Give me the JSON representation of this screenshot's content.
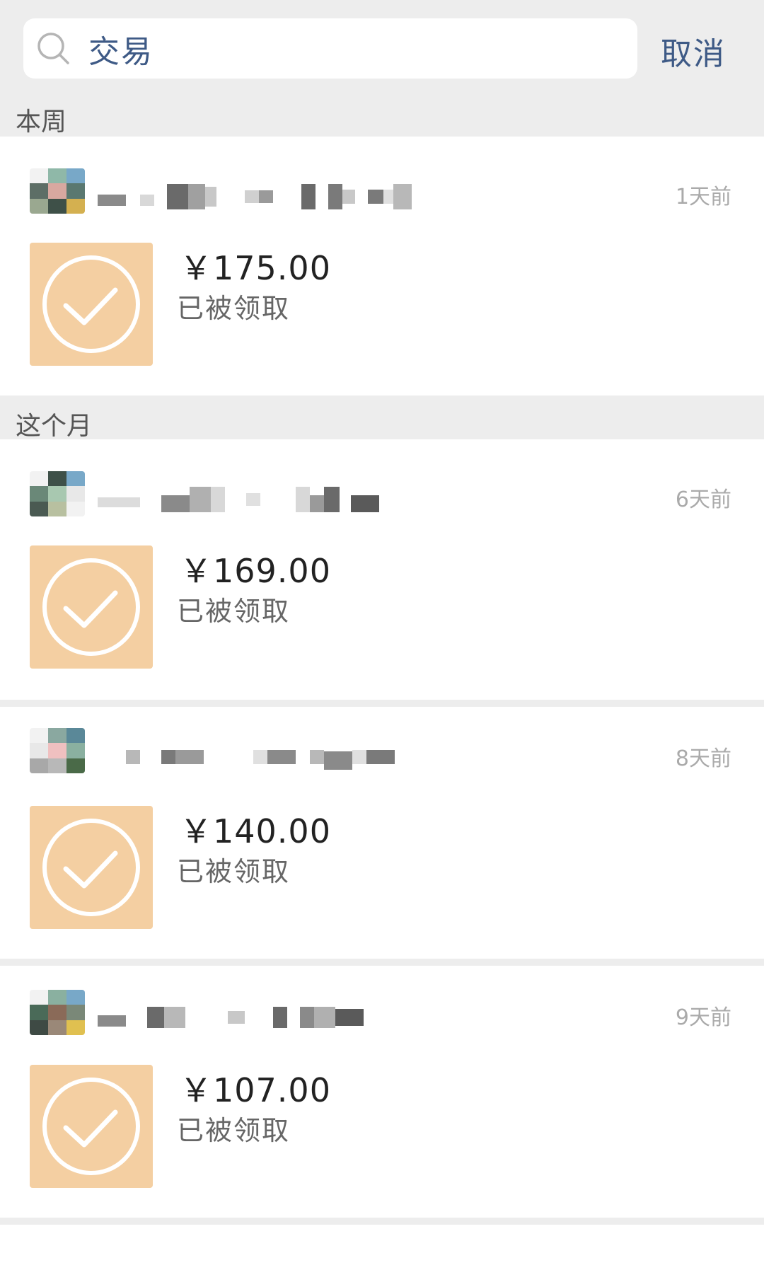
{
  "search": {
    "query": "交易",
    "cancel_label": "取消",
    "icon": "search-icon"
  },
  "sections": [
    {
      "label": "本周",
      "items": [
        {
          "time": "1天前",
          "amount": "￥175.00",
          "status": "已被领取"
        }
      ]
    },
    {
      "label": "这个月",
      "items": [
        {
          "time": "6天前",
          "amount": "￥169.00",
          "status": "已被领取"
        },
        {
          "time": "8天前",
          "amount": "￥140.00",
          "status": "已被领取"
        },
        {
          "time": "9天前",
          "amount": "￥107.00",
          "status": "已被领取"
        }
      ]
    }
  ],
  "colors": {
    "accent_text": "#3e5a86",
    "receipt_bg": "#f4cfa2",
    "page_bg": "#ededed"
  }
}
